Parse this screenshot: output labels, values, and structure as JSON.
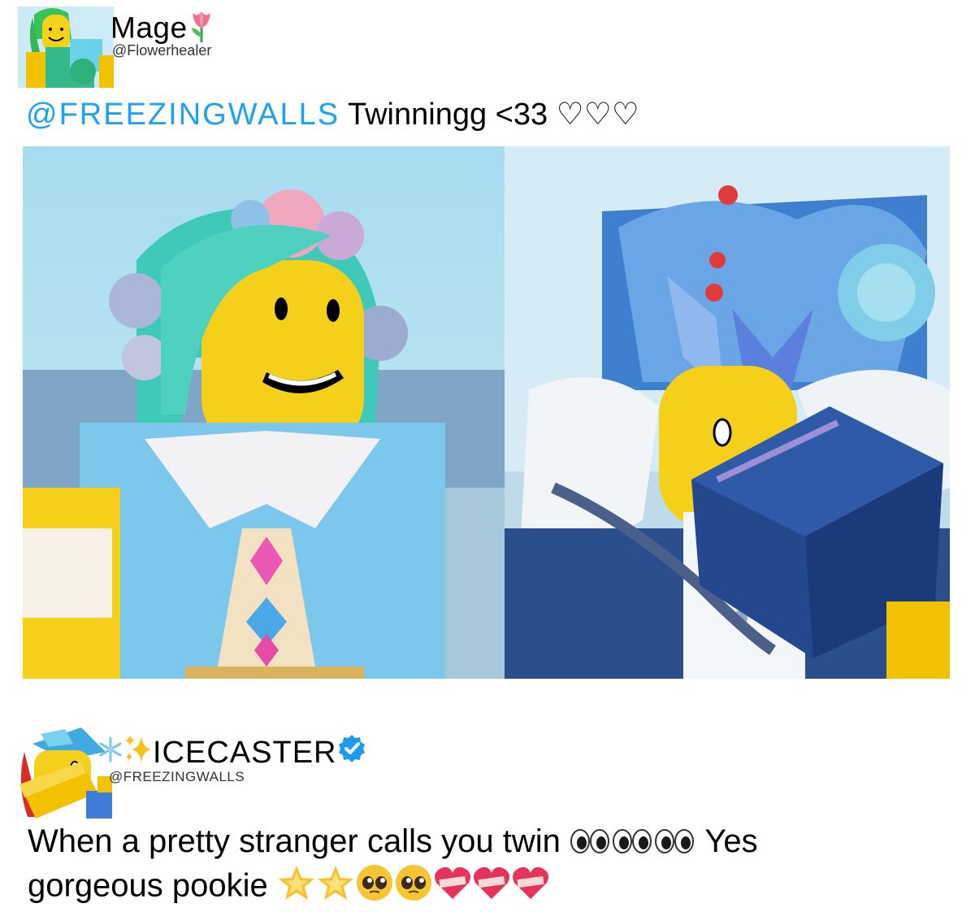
{
  "post1": {
    "display_name": "Mage",
    "name_emoji": "tulip-emoji",
    "handle": "@Flowerhealer",
    "mention": "@FREEZINGWALLS",
    "text": "Twinningg <33 ♡♡♡"
  },
  "images": {
    "left": "character-flower-crown",
    "right": "character-ice-crown"
  },
  "post2": {
    "name_emojis": [
      "snowflake-emoji",
      "sparkles-emoji"
    ],
    "display_name": "ICECASTER",
    "verified": true,
    "handle": "@FREEZINGWALLS",
    "text_line1": "When a pretty stranger calls you twin",
    "text_line1_end": "Yes",
    "text_line2": "gorgeous pookie",
    "line1_emojis": [
      "eyes-emoji",
      "eyes-emoji",
      "eyes-emoji"
    ],
    "line2_emojis": [
      "glowing-star-emoji",
      "glowing-star-emoji",
      "pleading-face-emoji",
      "pleading-face-emoji",
      "mending-heart-emoji",
      "mending-heart-emoji",
      "mending-heart-emoji"
    ]
  },
  "colors": {
    "mention": "#1da1f2",
    "verified": "#1d9bf0"
  }
}
